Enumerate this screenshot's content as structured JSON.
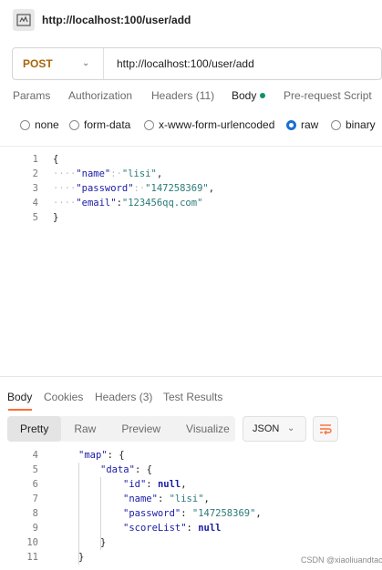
{
  "window": {
    "title": "http://localhost:100/user/add"
  },
  "request": {
    "method": "POST",
    "url": "http://localhost:100/user/add"
  },
  "request_tabs": {
    "params": "Params",
    "authorization": "Authorization",
    "headers": "Headers",
    "headers_count": "(11)",
    "body": "Body",
    "prerequest": "Pre-request Script"
  },
  "body_types": {
    "none": "none",
    "form_data": "form-data",
    "urlencoded": "x-www-form-urlencoded",
    "raw": "raw",
    "binary": "binary",
    "selected": "raw"
  },
  "editor": {
    "line_numbers": [
      "1",
      "2",
      "3",
      "4",
      "5"
    ],
    "lines": [
      {
        "open": "{"
      },
      {
        "ws": "····",
        "key": "\"name\"",
        "sep": ":·",
        "value": "\"lisi\"",
        "tail": ","
      },
      {
        "ws": "····",
        "key": "\"password\"",
        "sep": ":·",
        "value": "\"147258369\"",
        "tail": ","
      },
      {
        "ws": "····",
        "key": "\"email\"",
        "sep": ":",
        "value": "\"123456qq.com\"",
        "tail": ""
      },
      {
        "close": "}"
      }
    ]
  },
  "response_tabs": {
    "body": "Body",
    "cookies": "Cookies",
    "headers": "Headers (3)",
    "tests": "Test Results"
  },
  "response_toolbar": {
    "pretty": "Pretty",
    "raw": "Raw",
    "preview": "Preview",
    "visualize": "Visualize",
    "format": "JSON"
  },
  "response": {
    "line_numbers": [
      "4",
      "5",
      "6",
      "7",
      "8",
      "9",
      "10",
      "11"
    ],
    "l4": {
      "key": "\"map\"",
      "rest": ": {"
    },
    "l5": {
      "key": "\"data\"",
      "rest": ": {"
    },
    "l6": {
      "key": "\"id\"",
      "sep": ": ",
      "value": "null",
      "tail": ","
    },
    "l7": {
      "key": "\"name\"",
      "sep": ": ",
      "value": "\"lisi\"",
      "tail": ","
    },
    "l8": {
      "key": "\"password\"",
      "sep": ": ",
      "value": "\"147258369\"",
      "tail": ","
    },
    "l9": {
      "key": "\"scoreList\"",
      "sep": ": ",
      "value": "null",
      "tail": ""
    },
    "l10": "}",
    "l11": "}"
  },
  "watermark": "CSDN @xiaoliuandtac",
  "colors": {
    "method": "#a8640b",
    "accent": "#ff6c37",
    "dot": "#0c9463",
    "radio": "#1a6fd4"
  }
}
